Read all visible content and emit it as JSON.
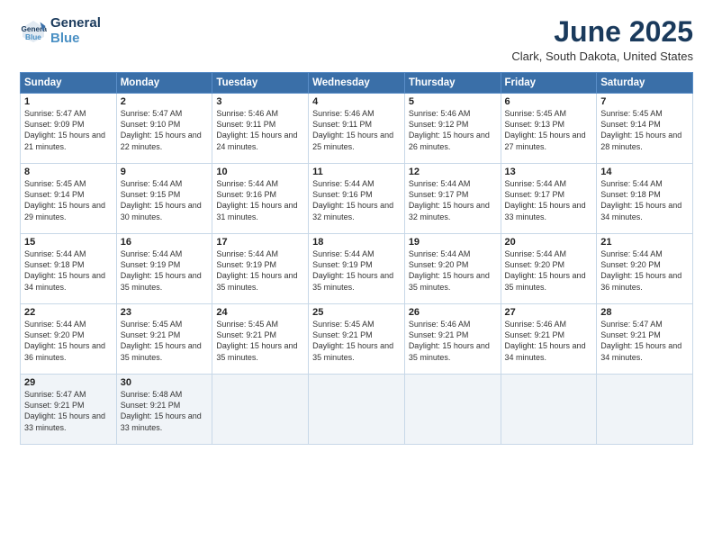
{
  "logo": {
    "line1": "General",
    "line2": "Blue"
  },
  "title": "June 2025",
  "subtitle": "Clark, South Dakota, United States",
  "days_of_week": [
    "Sunday",
    "Monday",
    "Tuesday",
    "Wednesday",
    "Thursday",
    "Friday",
    "Saturday"
  ],
  "weeks": [
    [
      {
        "day": "1",
        "rise": "5:47 AM",
        "set": "9:09 PM",
        "daylight": "15 hours and 21 minutes."
      },
      {
        "day": "2",
        "rise": "5:47 AM",
        "set": "9:10 PM",
        "daylight": "15 hours and 22 minutes."
      },
      {
        "day": "3",
        "rise": "5:46 AM",
        "set": "9:11 PM",
        "daylight": "15 hours and 24 minutes."
      },
      {
        "day": "4",
        "rise": "5:46 AM",
        "set": "9:11 PM",
        "daylight": "15 hours and 25 minutes."
      },
      {
        "day": "5",
        "rise": "5:46 AM",
        "set": "9:12 PM",
        "daylight": "15 hours and 26 minutes."
      },
      {
        "day": "6",
        "rise": "5:45 AM",
        "set": "9:13 PM",
        "daylight": "15 hours and 27 minutes."
      },
      {
        "day": "7",
        "rise": "5:45 AM",
        "set": "9:14 PM",
        "daylight": "15 hours and 28 minutes."
      }
    ],
    [
      {
        "day": "8",
        "rise": "5:45 AM",
        "set": "9:14 PM",
        "daylight": "15 hours and 29 minutes."
      },
      {
        "day": "9",
        "rise": "5:44 AM",
        "set": "9:15 PM",
        "daylight": "15 hours and 30 minutes."
      },
      {
        "day": "10",
        "rise": "5:44 AM",
        "set": "9:16 PM",
        "daylight": "15 hours and 31 minutes."
      },
      {
        "day": "11",
        "rise": "5:44 AM",
        "set": "9:16 PM",
        "daylight": "15 hours and 32 minutes."
      },
      {
        "day": "12",
        "rise": "5:44 AM",
        "set": "9:17 PM",
        "daylight": "15 hours and 32 minutes."
      },
      {
        "day": "13",
        "rise": "5:44 AM",
        "set": "9:17 PM",
        "daylight": "15 hours and 33 minutes."
      },
      {
        "day": "14",
        "rise": "5:44 AM",
        "set": "9:18 PM",
        "daylight": "15 hours and 34 minutes."
      }
    ],
    [
      {
        "day": "15",
        "rise": "5:44 AM",
        "set": "9:18 PM",
        "daylight": "15 hours and 34 minutes."
      },
      {
        "day": "16",
        "rise": "5:44 AM",
        "set": "9:19 PM",
        "daylight": "15 hours and 35 minutes."
      },
      {
        "day": "17",
        "rise": "5:44 AM",
        "set": "9:19 PM",
        "daylight": "15 hours and 35 minutes."
      },
      {
        "day": "18",
        "rise": "5:44 AM",
        "set": "9:19 PM",
        "daylight": "15 hours and 35 minutes."
      },
      {
        "day": "19",
        "rise": "5:44 AM",
        "set": "9:20 PM",
        "daylight": "15 hours and 35 minutes."
      },
      {
        "day": "20",
        "rise": "5:44 AM",
        "set": "9:20 PM",
        "daylight": "15 hours and 35 minutes."
      },
      {
        "day": "21",
        "rise": "5:44 AM",
        "set": "9:20 PM",
        "daylight": "15 hours and 36 minutes."
      }
    ],
    [
      {
        "day": "22",
        "rise": "5:44 AM",
        "set": "9:20 PM",
        "daylight": "15 hours and 36 minutes."
      },
      {
        "day": "23",
        "rise": "5:45 AM",
        "set": "9:21 PM",
        "daylight": "15 hours and 35 minutes."
      },
      {
        "day": "24",
        "rise": "5:45 AM",
        "set": "9:21 PM",
        "daylight": "15 hours and 35 minutes."
      },
      {
        "day": "25",
        "rise": "5:45 AM",
        "set": "9:21 PM",
        "daylight": "15 hours and 35 minutes."
      },
      {
        "day": "26",
        "rise": "5:46 AM",
        "set": "9:21 PM",
        "daylight": "15 hours and 35 minutes."
      },
      {
        "day": "27",
        "rise": "5:46 AM",
        "set": "9:21 PM",
        "daylight": "15 hours and 34 minutes."
      },
      {
        "day": "28",
        "rise": "5:47 AM",
        "set": "9:21 PM",
        "daylight": "15 hours and 34 minutes."
      }
    ],
    [
      {
        "day": "29",
        "rise": "5:47 AM",
        "set": "9:21 PM",
        "daylight": "15 hours and 33 minutes."
      },
      {
        "day": "30",
        "rise": "5:48 AM",
        "set": "9:21 PM",
        "daylight": "15 hours and 33 minutes."
      },
      null,
      null,
      null,
      null,
      null
    ]
  ]
}
